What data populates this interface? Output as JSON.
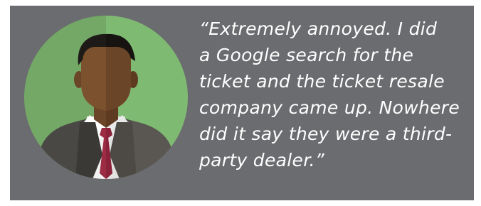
{
  "testimonial": {
    "quote_lines": [
      "“Extremely annoyed. I did",
      "a Google search for the",
      "ticket and the ticket resale",
      "company came up. Nowhere",
      "did it say they were a third-",
      "party dealer.”"
    ],
    "avatar_icon": "businessman-avatar-icon"
  },
  "colors": {
    "card_background": "#6b6c6f",
    "circle_left": "#74a866",
    "circle_right": "#7fba72",
    "quote_text": "#ffffff",
    "tie": "#9c2b44"
  }
}
